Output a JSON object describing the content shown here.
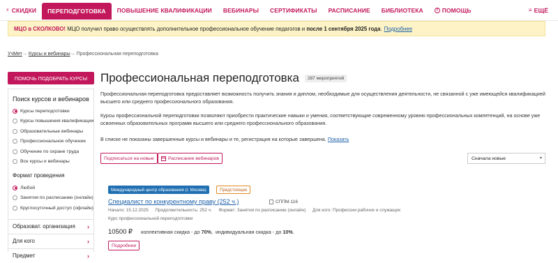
{
  "nav": {
    "items": [
      {
        "icon": "bolt-icon",
        "glyph": "⚡",
        "label": "СКИДКИ"
      },
      {
        "label": "ПЕРЕПОДГОТОВКА",
        "active": true
      },
      {
        "label": "ПОВЫШЕНИЕ КВАЛИФИКАЦИИ"
      },
      {
        "label": "ВЕБИНАРЫ"
      },
      {
        "label": "СЕРТИФИКАТЫ"
      },
      {
        "label": "РАСПИСАНИЕ"
      },
      {
        "label": "БИБЛИОТЕКА"
      },
      {
        "icon": "help-icon",
        "glyph": "?",
        "label": "ПОМОЩЬ"
      }
    ],
    "more_label": "ЕЩЁ",
    "more_glyph": "≡",
    "accent": "#c2185b"
  },
  "notice": {
    "highlight": "МЦО в СКОЛКОВО!",
    "text_before": " МЦО получил право осуществлять дополнительное профессиональное обучение педагогов и ",
    "bold": "после 1 сентября 2025 года",
    "text_after": ".",
    "link": "Подробнее"
  },
  "breadcrumb": {
    "home": "УчМет",
    "sep": "→",
    "section": "Курсы и вебинары",
    "current": "Профессиональная переподготовка"
  },
  "sidebar": {
    "pick_button": "ПОМОЧЬ ПОДОБРАТЬ КУРСЫ",
    "search_title": "Поиск курсов и вебинаров",
    "types": [
      {
        "label": "Курсы переподготовки",
        "selected": true
      },
      {
        "label": "Курсы повышения квалификации",
        "selected": false
      },
      {
        "label": "Образовательные вебинары",
        "selected": false
      },
      {
        "label": "Профессиональное обучение",
        "selected": false
      },
      {
        "label": "Обучение по охране труда",
        "selected": false
      },
      {
        "label": "Все курсы и вебинары",
        "selected": false
      }
    ],
    "format_title": "Формат проведения",
    "formats": [
      {
        "label": "Любой",
        "selected": true
      },
      {
        "label": "Занятия по расписанию (онлайн)",
        "selected": false
      },
      {
        "label": "Круглосуточный доступ (офлайн)",
        "selected": false
      }
    ],
    "accordions": [
      {
        "label": "Образоват. организация"
      },
      {
        "label": "Для кого"
      },
      {
        "label": "Предмет"
      }
    ]
  },
  "main": {
    "title": "Профессиональная переподготовка",
    "count": "287 мероприятий",
    "para1": "Профессиональная переподготовка предоставляет возможность получить знания и диплом, необходимые для осуществления деятельности, не связанной с уже имеющейся квалификацией высшего или среднего профессионального образования.",
    "para2": "Курсы профессиональной переподготовки позволяют приобрести практические навыки и умения, соответствующие современному уровню профессиональных компетенций, на основе уже освоенных образовательных программ высшего или среднего профессионального образования.",
    "para3": "В списке не показаны завершенные курсы и вебинары и те, регистрация на которые завершена.",
    "para3_link": "Показать",
    "subscribe_button": "Подписаться на новые",
    "schedule_button": "Расписание вебинаров",
    "sort_value": "Сначала новые"
  },
  "course": {
    "org_tag": "Международный центр образования (г. Москва)",
    "status_tag": "Предстоящее",
    "title": "Специалист по конкурентному праву (252 ч.)",
    "code": "СППМ-116",
    "start": "Начало: 15.12.2025",
    "duration": "Продолжительность: 252 ч.",
    "format": "Формат: Занятия по расписанию (онлайн)",
    "audience": "Для кого: Профессии рабочих и служащих",
    "type": "Курс профессиональной переподготовки",
    "price": "10500 ₽",
    "group_discount_label": "коллективная скидка - до ",
    "group_discount": "70%",
    "individual_discount_label": "индивидуальная скидка - до ",
    "individual_discount": "10%",
    "more_button": "Подробнее"
  }
}
